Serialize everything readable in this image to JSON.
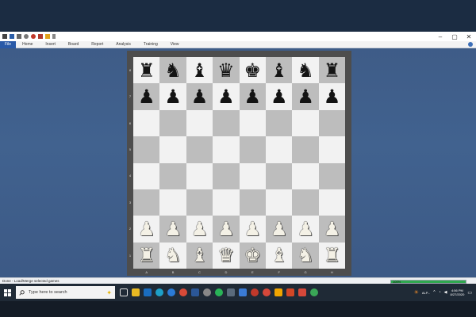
{
  "ribbon": {
    "tabs": [
      "File",
      "Home",
      "Insert",
      "Board",
      "Report",
      "Analysis",
      "Training",
      "View"
    ]
  },
  "board": {
    "files": [
      "A",
      "B",
      "C",
      "D",
      "E",
      "F",
      "G",
      "H"
    ],
    "ranks": [
      "8",
      "7",
      "6",
      "5",
      "4",
      "3",
      "2",
      "1"
    ],
    "position": [
      [
        "br",
        "bn",
        "bb",
        "bq",
        "bk",
        "bb",
        "bn",
        "br"
      ],
      [
        "bp",
        "bp",
        "bp",
        "bp",
        "bp",
        "bp",
        "bp",
        "bp"
      ],
      [
        "",
        "",
        "",
        "",
        "",
        "",
        "",
        ""
      ],
      [
        "",
        "",
        "",
        "",
        "",
        "",
        "",
        ""
      ],
      [
        "",
        "",
        "",
        "",
        "",
        "",
        "",
        ""
      ],
      [
        "",
        "",
        "",
        "",
        "",
        "",
        "",
        ""
      ],
      [
        "wp",
        "wp",
        "wp",
        "wp",
        "wp",
        "wp",
        "wp",
        "wp"
      ],
      [
        "wr",
        "wn",
        "wb",
        "wq",
        "wk",
        "wb",
        "wn",
        "wr"
      ]
    ],
    "light_color": "#f2f2f2",
    "dark_color": "#bdbdbd"
  },
  "status": {
    "text": "Done - Load/Merge selected games",
    "progress_label": "100%",
    "progress_value": 1.0
  },
  "taskbar": {
    "search_placeholder": "Type here to search",
    "tray_label": "ALP...",
    "time": "4:56 PM",
    "date": "8/27/2020"
  }
}
